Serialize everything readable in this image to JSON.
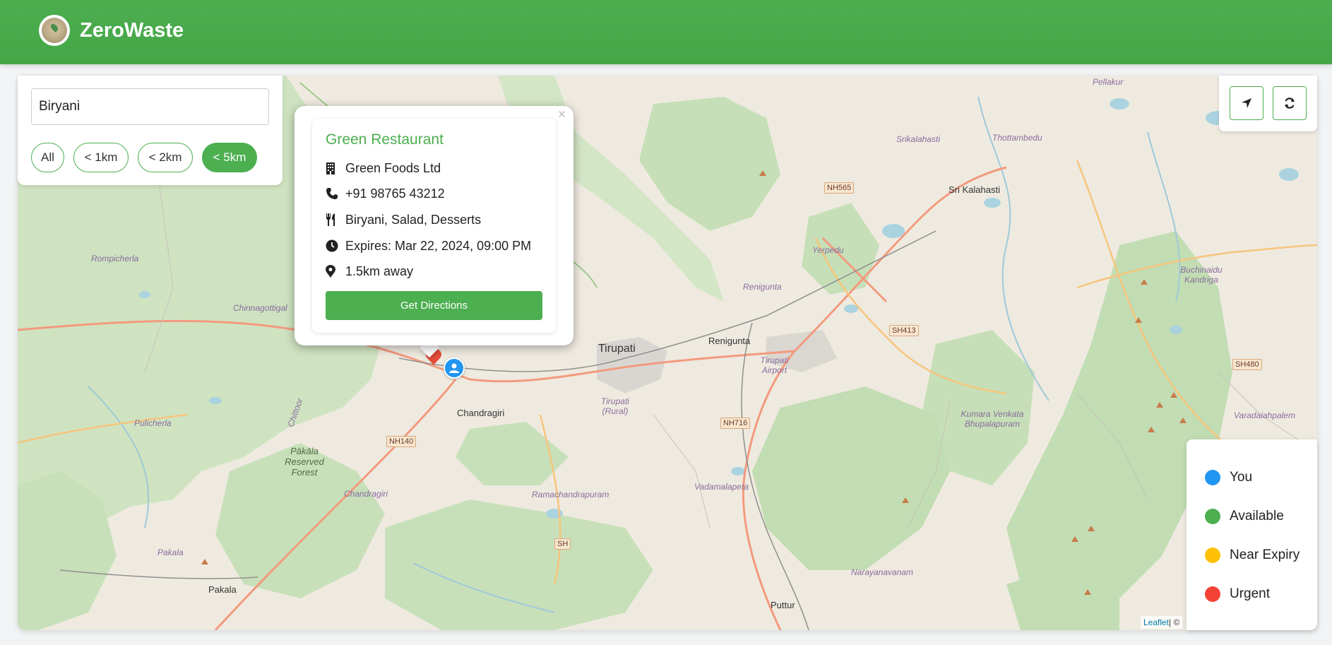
{
  "app": {
    "title": "ZeroWaste"
  },
  "search": {
    "value": "Biryani"
  },
  "filters": [
    {
      "label": "All",
      "active": false
    },
    {
      "label": "< 1km",
      "active": false
    },
    {
      "label": "< 2km",
      "active": false
    },
    {
      "label": "< 5km",
      "active": true
    }
  ],
  "controls": {
    "locate_icon": "location-arrow-icon",
    "refresh_icon": "refresh-icon"
  },
  "popup": {
    "title": "Green Restaurant",
    "company": "Green Foods Ltd",
    "phone": "+91 98765 43212",
    "items": "Biryani, Salad, Desserts",
    "expires": "Expires: Mar 22, 2024, 09:00 PM",
    "distance": "1.5km away",
    "button": "Get Directions",
    "close": "×"
  },
  "legend": [
    {
      "label": "You",
      "color": "#2196f3"
    },
    {
      "label": "Available",
      "color": "#4caf50"
    },
    {
      "label": "Near Expiry",
      "color": "#ffc107"
    },
    {
      "label": "Urgent",
      "color": "#f44336"
    }
  ],
  "map_labels": {
    "tirupati": "Tirupati",
    "renigunta": "Renigunta",
    "renigunta_italic": "Renigunta",
    "tirupati_airport": "Tirupati Airport",
    "tirupati_rural": "Tirupati (Rural)",
    "chandragiri": "Chandragiri",
    "chandragiri_italic": "Chandragiri",
    "sri_kalahasti": "Sri Kalahasti",
    "srikalahasti": "Srikalahasti",
    "thottambedu": "Thottambedu",
    "pellakur": "Pellakur",
    "yerpedu": "Yerpedu",
    "rompicherla": "Rompicherla",
    "chinnagottigal": "Chinnagottigal",
    "pulicherla": "Pulicherla",
    "pakala_forest": "Pākāla Reserved Forest",
    "chittoor": "Chittoor",
    "ramachandrapuram": "Ramachandrapuram",
    "vadamalapeta": "Vadamalapeta",
    "narayanavanam": "Narayanavanam",
    "puttur": "Puttur",
    "pakala": "Pakala",
    "pakala_italic": "Pakala",
    "kumara": "Kumara Venkata Bhupalapuram",
    "buchinaidu": "Buchinaidu Kandriga",
    "varadaiahpalem": "Varadaiahpalem"
  },
  "road_shields": {
    "nh565": "NH565",
    "sh413": "SH413",
    "sh480": "SH480",
    "nh716": "NH716",
    "nh140": "NH140",
    "sh": "SH"
  },
  "attribution": {
    "leaflet": "Leaflet",
    "rest": " | ©"
  }
}
